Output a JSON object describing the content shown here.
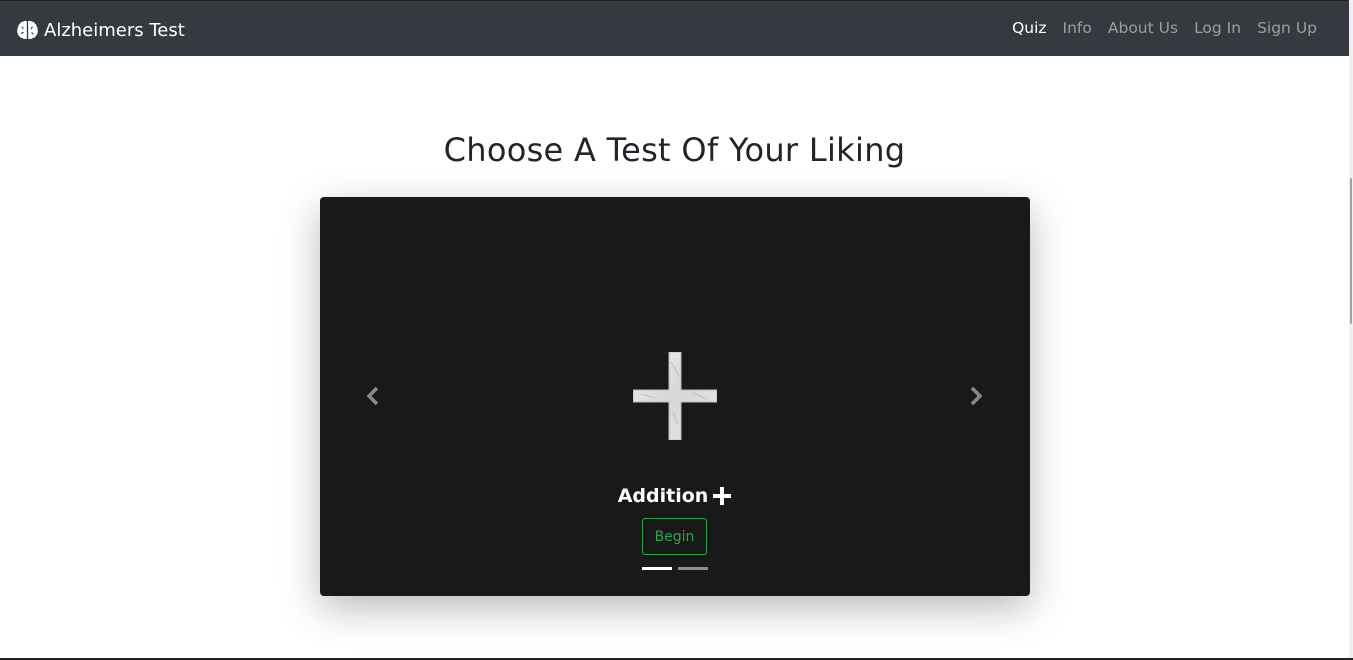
{
  "brand": {
    "title": "Alzheimers Test",
    "icon": "brain-icon"
  },
  "nav": {
    "items": [
      {
        "label": "Quiz",
        "active": true
      },
      {
        "label": "Info",
        "active": false
      },
      {
        "label": "About Us",
        "active": false
      },
      {
        "label": "Log In",
        "active": false
      },
      {
        "label": "Sign Up",
        "active": false
      }
    ]
  },
  "main": {
    "title": "Choose A Test Of Your Liking"
  },
  "carousel": {
    "slides": [
      {
        "caption": "Addition",
        "caption_icon": "plus-icon",
        "image_icon": "plus-image",
        "button_label": "Begin",
        "active": true
      },
      {
        "active": false
      }
    ],
    "prev_icon": "chevron-left-icon",
    "next_icon": "chevron-right-icon"
  },
  "colors": {
    "navbar": "#343a40",
    "carousel_bg": "#191919",
    "success": "#28a745"
  }
}
